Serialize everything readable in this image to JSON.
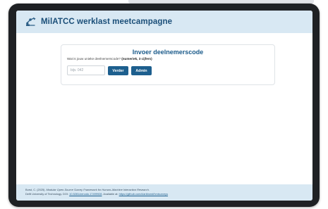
{
  "header": {
    "title": "MilATCC werklast meetcampagne",
    "logo_icon": "mechanical-arm-logo-icon"
  },
  "card": {
    "title": "Invoer deelnemerscode",
    "question": "Wat is jouw unieke deelnemerscode?",
    "question_hint": "(numeriek, 3 cijfers)",
    "input_placeholder": "bijv. 042",
    "input_value": "",
    "verder_label": "Verder",
    "admin_label": "Admin"
  },
  "footer": {
    "citation_prefix": "Borst, C. (2025).",
    "citation_title": "Modular Open-Source Survey Framework for Human–Machine Interaction Research.",
    "citation_line2_prefix": "Delft University of Technology. DOI:",
    "doi_link": "10.5281/zenodo.17499928",
    "available_text": ". Available at:",
    "github_link": "https://github.com/clarkborst/hmisurveys"
  },
  "colors": {
    "header_bg": "#d8e8f3",
    "accent": "#1d5f8e",
    "title_text": "#1a4e78",
    "device_frame": "#1f2124"
  }
}
